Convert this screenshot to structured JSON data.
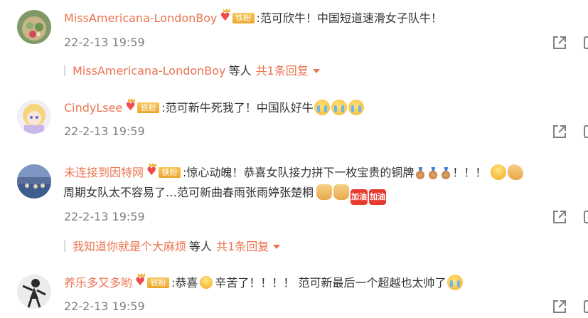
{
  "badge_label": "铁粉",
  "comments": [
    {
      "username": "MissAmericana-LondonBoy",
      "text": ":范可欣牛！中国短道速滑女子队牛！",
      "time": "22-2-13 19:59",
      "reply": {
        "name": "MissAmericana-LondonBoy",
        "etc": "等人",
        "count": "共1条回复"
      }
    },
    {
      "username": "CindyLsee",
      "text": ":范可新牛死我了！中国队好牛",
      "emojis": [
        "crying-emoji",
        "crying-emoji",
        "crying-emoji"
      ],
      "time": "22-2-13 19:59"
    },
    {
      "username": "未连接到因特网",
      "text_line1": ":惊心动魄！恭喜女队接力拼下一枚宝贵的铜牌",
      "text_line1_end": "！！！",
      "text_line2": "周期女队太不容易了…范可新曲春雨张雨婷张楚桐",
      "gift_label": "加油",
      "time": "22-2-13 19:59",
      "reply": {
        "name": "我知道你就是个大麻烦",
        "etc": "等人",
        "count": "共1条回复"
      }
    },
    {
      "username": "养乐多又多哟",
      "text_a": ":恭喜",
      "text_b": "辛苦了！！！！ 范可新最后一个超越也太帅了",
      "time": "22-2-13 19:59"
    }
  ],
  "colors": {
    "username": "#eb7350",
    "time": "#808080",
    "text": "#333333"
  }
}
